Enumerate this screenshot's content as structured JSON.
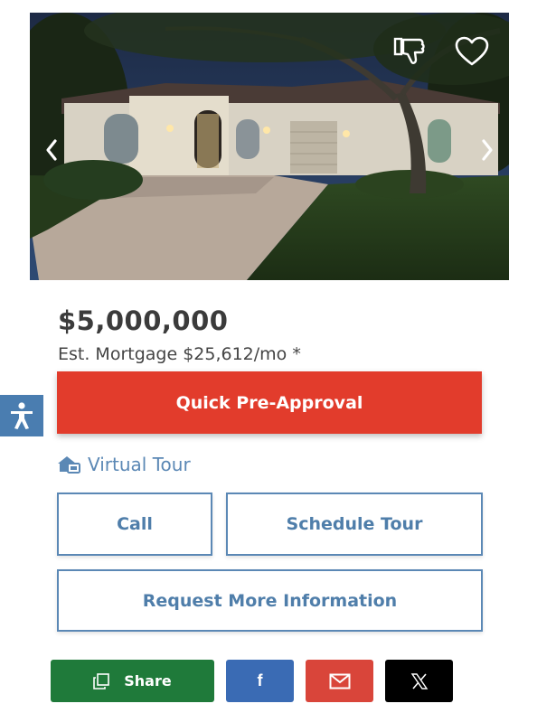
{
  "listing": {
    "price": "$5,000,000",
    "mortgage": "Est. Mortgage $25,612/mo *",
    "photo_subject": "house-exterior-at-dusk"
  },
  "actions": {
    "preapproval_label": "Quick Pre-Approval",
    "virtual_tour_label": "Virtual Tour",
    "call_label": "Call",
    "schedule_label": "Schedule Tour",
    "request_label": "Request More Information"
  },
  "share": {
    "share_label": "Share",
    "facebook_icon": "f"
  },
  "colors": {
    "accent_red": "#e23c2c",
    "link_blue": "#5b88b5",
    "share_green": "#1f7a3a",
    "facebook_blue": "#3a6bb4",
    "mail_red": "#d9453a",
    "x_black": "#000000",
    "a11y_blue": "#4a7db0"
  },
  "icons": [
    "thumbs-down-icon",
    "heart-icon",
    "chevron-left-icon",
    "chevron-right-icon",
    "accessibility-icon",
    "virtual-tour-house-icon",
    "copy-icon",
    "facebook-icon",
    "mail-icon",
    "x-logo-icon"
  ]
}
